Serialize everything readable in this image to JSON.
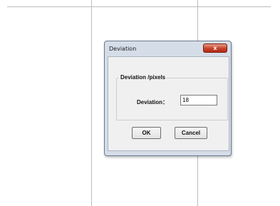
{
  "dialog": {
    "title": "Deviation",
    "close_label": "x",
    "group_title": "Deviation /pixels",
    "field_label": "Deviation：",
    "field_value": "18",
    "ok_label": "OK",
    "cancel_label": "Cancel"
  },
  "colors": {
    "frame": "#d5dde8",
    "client": "#f0f0f0",
    "close_button": "#c7412a",
    "grid_lines": "#bdbdbd"
  }
}
